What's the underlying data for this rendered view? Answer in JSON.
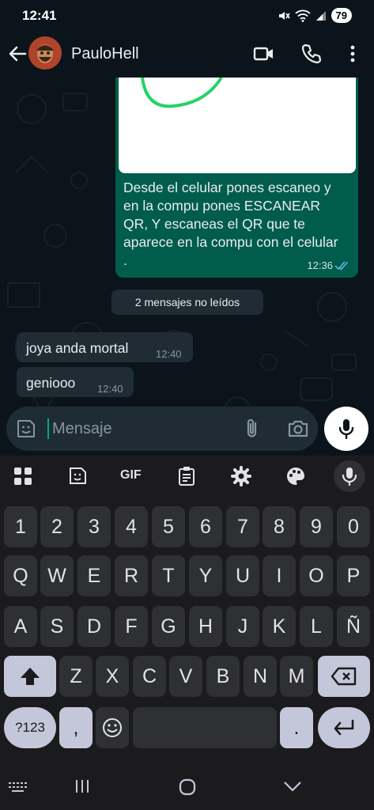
{
  "status": {
    "time": "12:41",
    "battery": "79"
  },
  "header": {
    "contact_name": "PauloHell"
  },
  "messages": {
    "outgoing": {
      "text": "Desde el celular pones escaneo y en la compu pones ESCANEAR QR, Y escaneas el QR que te aparece en la compu con el celular .",
      "time": "12:36"
    },
    "unread_banner": "2 mensajes no leídos",
    "incoming": [
      {
        "text": "joya anda mortal",
        "time": "12:40"
      },
      {
        "text": "geniooo",
        "time": "12:40"
      }
    ]
  },
  "input": {
    "placeholder": "Mensaje"
  },
  "keyboard": {
    "toolbar": [
      "grid-icon",
      "sticker-icon",
      "GIF",
      "clipboard-icon",
      "settings-icon",
      "palette-icon",
      "mic-icon"
    ],
    "gif_label": "GIF",
    "row_numbers": [
      "1",
      "2",
      "3",
      "4",
      "5",
      "6",
      "7",
      "8",
      "9",
      "0"
    ],
    "row1": [
      "Q",
      "W",
      "E",
      "R",
      "T",
      "Y",
      "U",
      "I",
      "O",
      "P"
    ],
    "row2": [
      "A",
      "S",
      "D",
      "F",
      "G",
      "H",
      "J",
      "K",
      "L",
      "Ñ"
    ],
    "row3": [
      "Z",
      "X",
      "C",
      "V",
      "B",
      "N",
      "M"
    ],
    "symbols_label": "?123",
    "comma_label": ",",
    "period_label": "."
  },
  "colors": {
    "outgoing_bubble": "#005c4b",
    "incoming_bubble": "#1f2c34",
    "accent": "#00a884",
    "read_ticks": "#53bdeb"
  }
}
